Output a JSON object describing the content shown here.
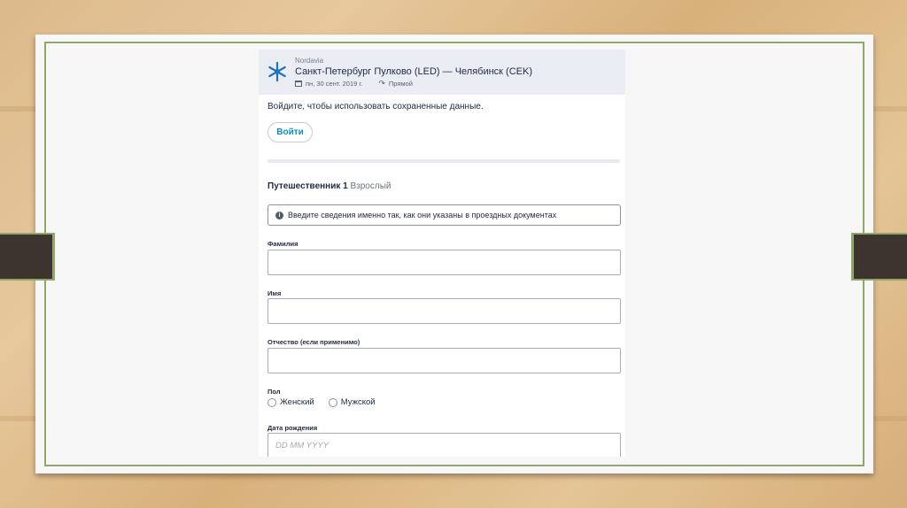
{
  "flight": {
    "airline": "Nordavia",
    "route": "Санкт-Петербург Пулково (LED) — Челябинск (CEK)",
    "date": "пн, 30 сент. 2019 г.",
    "direct": "Прямой"
  },
  "signin": {
    "prompt": "Войдите, чтобы использовать сохраненные данные.",
    "button_label": "Войти"
  },
  "traveler": {
    "title": "Путешественник 1",
    "type": "Взрослый",
    "info_message": "Введите сведения именно так, как они указаны в проездных документах"
  },
  "fields": {
    "last_name_label": "Фамилия",
    "first_name_label": "Имя",
    "middle_name_label": "Отчество (если применимо)",
    "gender_label": "Пол",
    "gender_female": "Женский",
    "gender_male": "Мужской",
    "birth_date_label": "Дата рождения",
    "birth_date_placeholder": "DD MM YYYY"
  },
  "colors": {
    "accent": "#0b8fbf",
    "frame": "#8fa86a",
    "header_bg": "#ebedf4"
  }
}
